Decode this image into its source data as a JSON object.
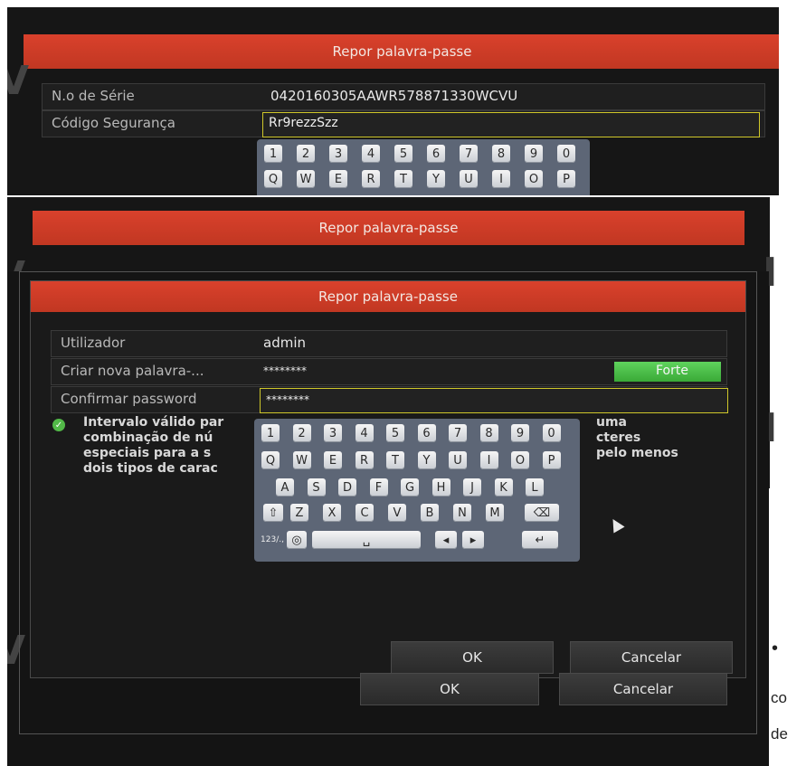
{
  "top_dialog": {
    "title": "Repor palavra-passe",
    "serial_label": "N.o de Série",
    "serial_value": "0420160305AAWR578871330WCVU",
    "security_label": "Código Segurança",
    "security_value": "Rr9rezzSzz",
    "keys_row1": [
      "1",
      "2",
      "3",
      "4",
      "5",
      "6",
      "7",
      "8",
      "9",
      "0"
    ],
    "keys_row2": [
      "Q",
      "W",
      "E",
      "R",
      "T",
      "Y",
      "U",
      "I",
      "O",
      "P"
    ]
  },
  "middle_dialog": {
    "title": "Repor palavra-passe",
    "ok_label": "OK",
    "cancel_label": "Cancelar"
  },
  "inner_dialog": {
    "title": "Repor palavra-passe",
    "user_label": "Utilizador",
    "user_value": "admin",
    "new_password_label": "Criar nova palavra-...",
    "new_password_value": "********",
    "strength_label": "Forte",
    "confirm_label": "Confirmar password",
    "confirm_value": "********",
    "hint_lines": [
      "Intervalo válido par",
      "combinação de nú",
      "especiais para a s",
      "dois tipos de carac"
    ],
    "hint_right_lines": [
      "uma",
      "cteres",
      "pelo menos"
    ],
    "ok_label": "OK",
    "cancel_label": "Cancelar",
    "keyboard": {
      "row1": [
        "1",
        "2",
        "3",
        "4",
        "5",
        "6",
        "7",
        "8",
        "9",
        "0"
      ],
      "row2": [
        "Q",
        "W",
        "E",
        "R",
        "T",
        "Y",
        "U",
        "I",
        "O",
        "P"
      ],
      "row3": [
        "A",
        "S",
        "D",
        "F",
        "G",
        "H",
        "J",
        "K",
        "L"
      ],
      "row4": [
        "Z",
        "X",
        "C",
        "V",
        "B",
        "N",
        "M"
      ],
      "symbols_label": "123/.,"
    }
  }
}
